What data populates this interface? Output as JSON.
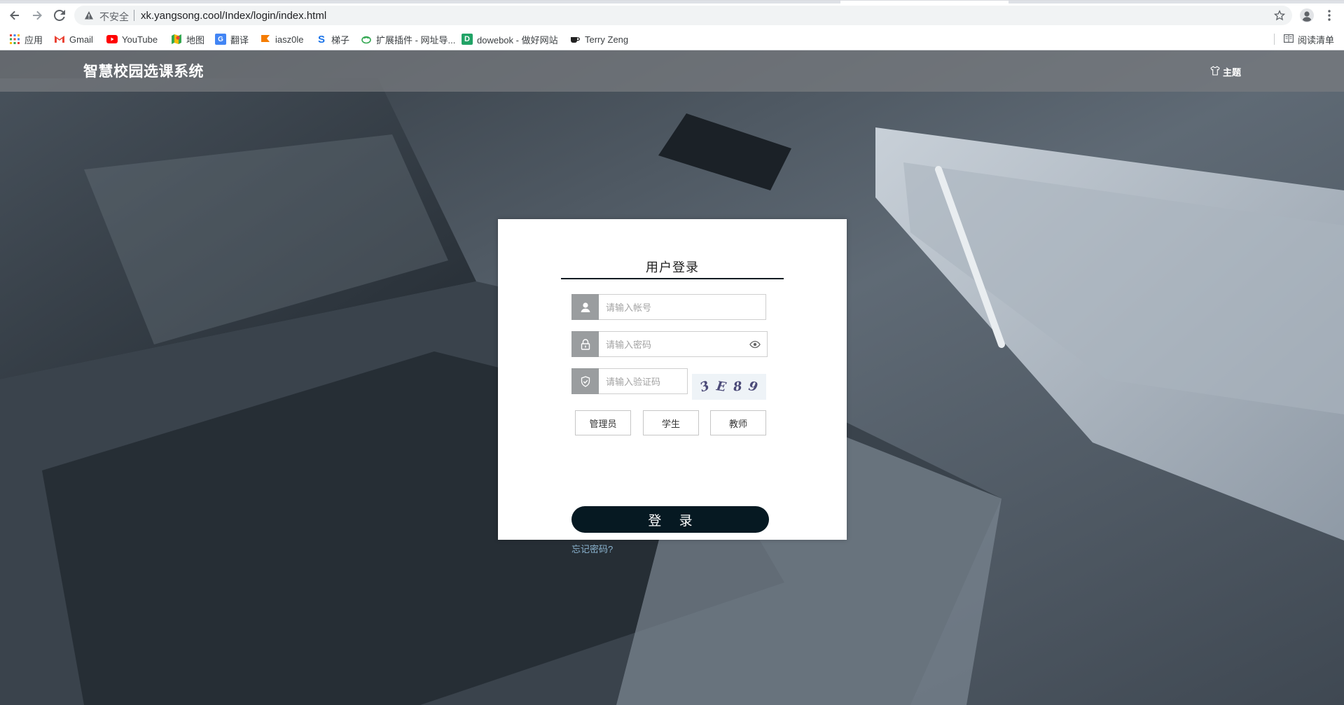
{
  "browser": {
    "insecure_label": "不安全",
    "url": "xk.yangsong.cool/Index/login/index.html",
    "icons": {
      "back": "back-arrow-icon",
      "forward": "forward-arrow-icon",
      "reload": "reload-icon",
      "warning": "warning-triangle-icon",
      "star": "star-icon",
      "profile": "profile-icon",
      "menu": "kebab-menu-icon"
    }
  },
  "bookmarks": {
    "items": [
      {
        "label": "应用",
        "icon": "apps-grid-icon"
      },
      {
        "label": "Gmail",
        "icon": "gmail-icon"
      },
      {
        "label": "YouTube",
        "icon": "youtube-icon"
      },
      {
        "label": "地图",
        "icon": "maps-icon"
      },
      {
        "label": "翻译",
        "icon": "translate-icon"
      },
      {
        "label": "iasz0le",
        "icon": "flag-icon"
      },
      {
        "label": "梯子",
        "icon": "s-logo-icon"
      },
      {
        "label": "扩展插件 - 网址导...",
        "icon": "extension-icon"
      },
      {
        "label": "dowebok - 做好网站",
        "icon": "d-logo-icon"
      },
      {
        "label": "Terry Zeng",
        "icon": "coffee-icon"
      }
    ],
    "reading_list": "阅读清单"
  },
  "header": {
    "title": "智慧校园选课系统",
    "theme_label": "主题"
  },
  "login": {
    "title": "用户登录",
    "account_placeholder": "请输入帐号",
    "password_placeholder": "请输入密码",
    "captcha_placeholder": "请输入验证码",
    "captcha_chars": [
      "3",
      "E",
      "8",
      "9"
    ],
    "roles": [
      "管理员",
      "学生",
      "教师"
    ],
    "submit_label": "登 录",
    "forgot_label": "忘记密码?"
  },
  "colors": {
    "login_button": "#061922",
    "addon_bg": "#9a9d9f",
    "forgot_link": "#8bb4d0"
  }
}
